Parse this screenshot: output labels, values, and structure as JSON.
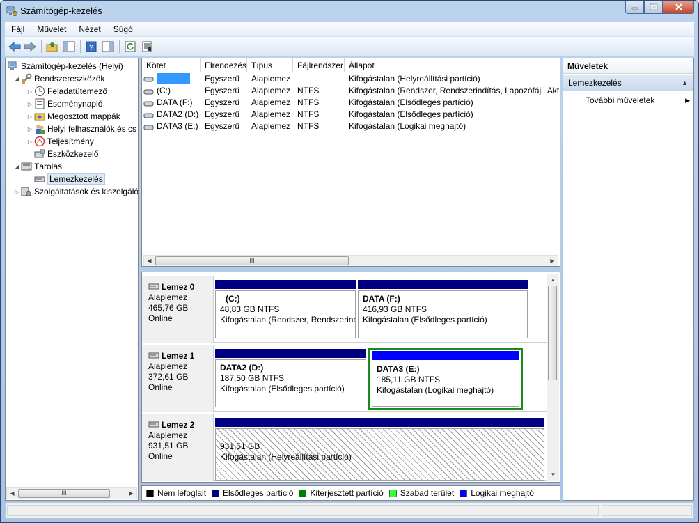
{
  "window": {
    "title": "Számítógép-kezelés"
  },
  "menu": [
    "Fájl",
    "Művelet",
    "Nézet",
    "Súgó"
  ],
  "toolbar": {
    "icons": [
      "back-icon",
      "forward-icon",
      "up-folder-icon",
      "show-hide-tree-icon",
      "help-icon",
      "show-hide-action-pane-icon",
      "refresh-icon",
      "properties-icon"
    ]
  },
  "tree": {
    "root": "Számítógép-kezelés (Helyi)",
    "system_tools": "Rendszereszközök",
    "task_scheduler": "Feladatütemező",
    "event_viewer": "Eseménynapló",
    "shared_folders": "Megosztott mappák",
    "local_users": "Helyi felhasználók és cs",
    "performance": "Teljesítmény",
    "device_manager": "Eszközkezelő",
    "storage": "Tárolás",
    "disk_management": "Lemezkezelés",
    "services": "Szolgáltatások és kiszolgáló",
    "hscroll_label": "III"
  },
  "volumes": {
    "columns": [
      "Kötet",
      "Elrendezés",
      "Típus",
      "Fájlrendszer",
      "Állapot"
    ],
    "rows": [
      {
        "volume": "",
        "layout": "Egyszerű",
        "type": "Alaplemez",
        "fs": "",
        "status": "Kifogástalan (Helyreállítási partíció)"
      },
      {
        "volume": "(C:)",
        "layout": "Egyszerű",
        "type": "Alaplemez",
        "fs": "NTFS",
        "status": "Kifogástalan (Rendszer, Rendszerindítás, Lapozófájl, Aktív,"
      },
      {
        "volume": "DATA (F:)",
        "layout": "Egyszerű",
        "type": "Alaplemez",
        "fs": "NTFS",
        "status": "Kifogástalan (Elsődleges partíció)"
      },
      {
        "volume": "DATA2 (D:)",
        "layout": "Egyszerű",
        "type": "Alaplemez",
        "fs": "NTFS",
        "status": "Kifogástalan (Elsődleges partíció)"
      },
      {
        "volume": "DATA3 (E:)",
        "layout": "Egyszerű",
        "type": "Alaplemez",
        "fs": "NTFS",
        "status": "Kifogástalan (Logikai meghajtó)"
      }
    ],
    "hscroll_label": "III"
  },
  "disks": [
    {
      "name": "Lemez 0",
      "kind": "Alaplemez",
      "size": "465,76 GB",
      "state": "Online",
      "partitions": [
        {
          "name": "(C:)",
          "size": "48,83 GB NTFS",
          "status": "Kifogástalan (Rendszer, Rendszerind"
        },
        {
          "name": "DATA  (F:)",
          "size": "416,93 GB NTFS",
          "status": "Kifogástalan (Elsődleges partíció)"
        }
      ]
    },
    {
      "name": "Lemez 1",
      "kind": "Alaplemez",
      "size": "372,61 GB",
      "state": "Online",
      "partitions": [
        {
          "name": "DATA2  (D:)",
          "size": "187,50 GB NTFS",
          "status": "Kifogástalan (Elsődleges partíció)"
        },
        {
          "name": "DATA3  (E:)",
          "size": "185,11 GB NTFS",
          "status": "Kifogástalan (Logikai meghajtó)"
        }
      ]
    },
    {
      "name": "Lemez 2",
      "kind": "Alaplemez",
      "size": "931,51 GB",
      "state": "Online",
      "partitions": [
        {
          "name": "",
          "size": "931,51 GB",
          "status": "Kifogástalan (Helyreállítási partíció)"
        }
      ]
    }
  ],
  "legend": [
    {
      "label": "Nem lefoglalt",
      "color": "#000000"
    },
    {
      "label": "Elsődleges partíció",
      "color": "#00007f"
    },
    {
      "label": "Kiterjesztett partíció",
      "color": "#008000"
    },
    {
      "label": "Szabad terület",
      "color": "#33ff33"
    },
    {
      "label": "Logikai meghajtó",
      "color": "#0000ff"
    }
  ],
  "colors": {
    "primary_partition": "#000080",
    "logical_drive": "#0000ff",
    "extended_border": "#1a8a1a",
    "selection": "#3399ff"
  },
  "actions": {
    "header": "Műveletek",
    "section": "Lemezkezelés",
    "more": "További műveletek"
  }
}
